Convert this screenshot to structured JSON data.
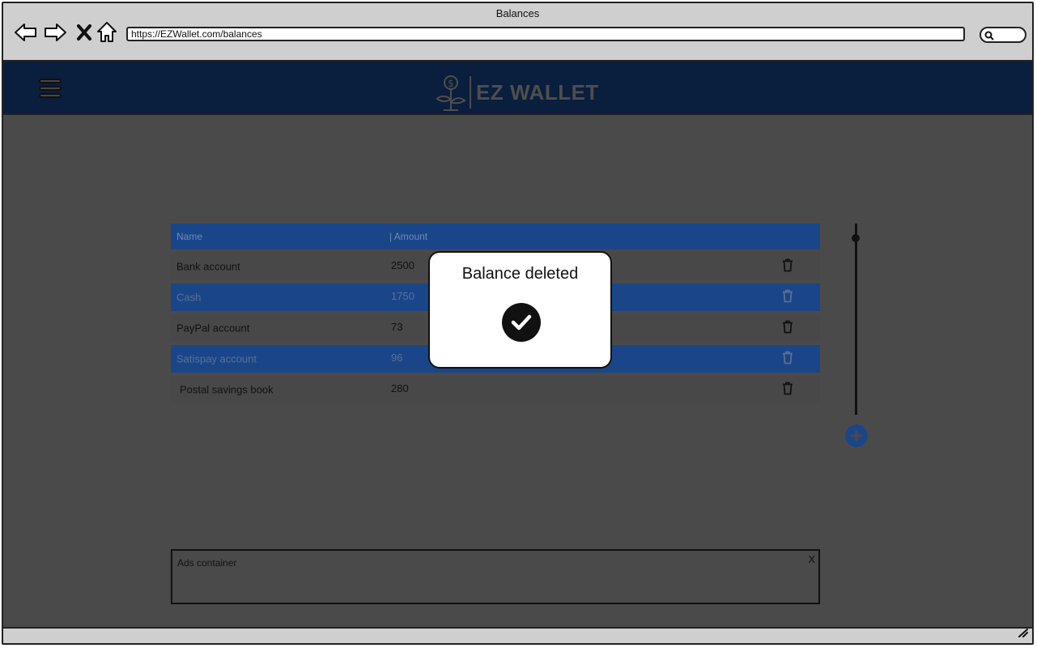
{
  "browser": {
    "window_title": "Balances",
    "url": "https://EZWallet.com/balances"
  },
  "app": {
    "brand": "EZ WALLET"
  },
  "table": {
    "columns": {
      "name": "Name",
      "amount": "| Amount"
    },
    "rows": [
      {
        "name": "Bank account",
        "amount": "2500"
      },
      {
        "name": "Cash",
        "amount": "1750"
      },
      {
        "name": "PayPal account",
        "amount": "73"
      },
      {
        "name": "Satispay account",
        "amount": "96"
      },
      {
        "name": "Postal savings book",
        "amount": "280"
      }
    ]
  },
  "ads": {
    "label": "Ads container",
    "close": "X"
  },
  "modal": {
    "title": "Balance deleted"
  },
  "colors": {
    "header_bg": "#0a1e3d",
    "accent_blue": "#1a4689",
    "overlay": "#4a4a4a"
  }
}
